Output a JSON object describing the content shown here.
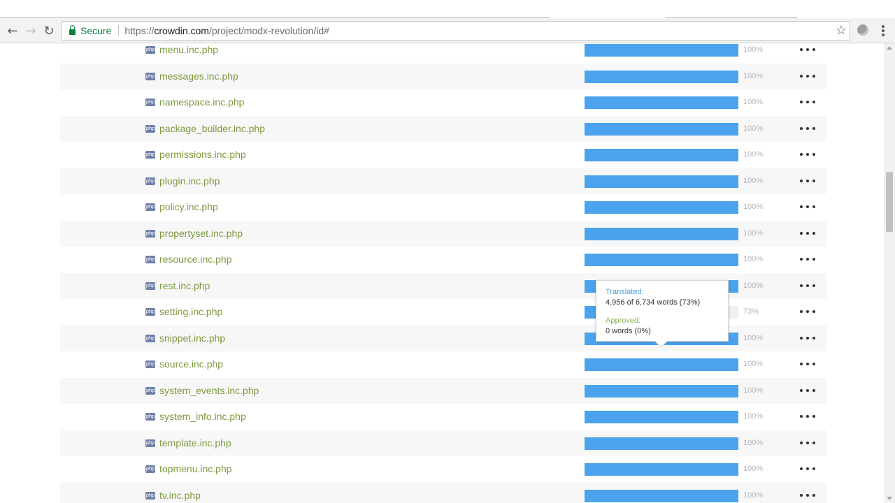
{
  "browser": {
    "secure_label": "Secure",
    "url_scheme": "https://",
    "url_domain": "crowdin.com",
    "url_path": "/project/modx-revolution/id#"
  },
  "icons": {
    "back": "arrow-left-icon",
    "forward": "arrow-right-icon",
    "reload": "reload-icon",
    "lock": "lock-icon",
    "bookmark": "star-icon",
    "extension": "extension-icon",
    "menu": "kebab-menu-icon",
    "file": "php-file-icon",
    "more": "more-horizontal-icon"
  },
  "colors": {
    "progress_bar": "#4aa3ec",
    "file_link": "#7d9a3f",
    "translated_label": "#4a9ad7",
    "approved_label": "#8bb352"
  },
  "file_badge": "php",
  "files": [
    {
      "name": "menu.inc.php",
      "progress": 100,
      "label": "100%"
    },
    {
      "name": "messages.inc.php",
      "progress": 100,
      "label": "100%"
    },
    {
      "name": "namespace.inc.php",
      "progress": 100,
      "label": "100%"
    },
    {
      "name": "package_builder.inc.php",
      "progress": 100,
      "label": "100%"
    },
    {
      "name": "permissions.inc.php",
      "progress": 100,
      "label": "100%"
    },
    {
      "name": "plugin.inc.php",
      "progress": 100,
      "label": "100%"
    },
    {
      "name": "policy.inc.php",
      "progress": 100,
      "label": "100%"
    },
    {
      "name": "propertyset.inc.php",
      "progress": 100,
      "label": "100%"
    },
    {
      "name": "resource.inc.php",
      "progress": 100,
      "label": "100%"
    },
    {
      "name": "rest.inc.php",
      "progress": 100,
      "label": "100%"
    },
    {
      "name": "setting.inc.php",
      "progress": 73,
      "label": "73%"
    },
    {
      "name": "snippet.inc.php",
      "progress": 100,
      "label": "100%"
    },
    {
      "name": "source.inc.php",
      "progress": 100,
      "label": "100%"
    },
    {
      "name": "system_events.inc.php",
      "progress": 100,
      "label": "100%"
    },
    {
      "name": "system_info.inc.php",
      "progress": 100,
      "label": "100%"
    },
    {
      "name": "template.inc.php",
      "progress": 100,
      "label": "100%"
    },
    {
      "name": "topmenu.inc.php",
      "progress": 100,
      "label": "100%"
    },
    {
      "name": "tv.inc.php",
      "progress": 100,
      "label": "100%"
    }
  ],
  "tooltip": {
    "translated_label": "Translated:",
    "translated_value": "4,956 of 6,734 words (73%)",
    "approved_label": "Approved:",
    "approved_value": "0 words (0%)"
  }
}
